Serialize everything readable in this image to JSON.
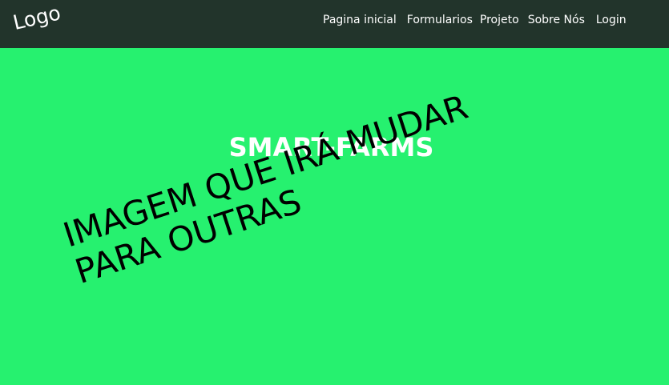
{
  "nav": {
    "logo": "Logo",
    "links": [
      {
        "label": "Pagina inicial"
      },
      {
        "label": "Formularios"
      },
      {
        "label": "Projeto"
      },
      {
        "label": "Sobre Nós"
      },
      {
        "label": "Login"
      }
    ]
  },
  "hero": {
    "title": "SMART-FARMS",
    "placeholder_lines": [
      "IMAGEM QUE IRÁ MUDAR",
      "PARA OUTRAS"
    ],
    "background_color": "#26f16f"
  },
  "colors": {
    "navbar_background": "#22342b",
    "hero_background": "#26f16f"
  }
}
